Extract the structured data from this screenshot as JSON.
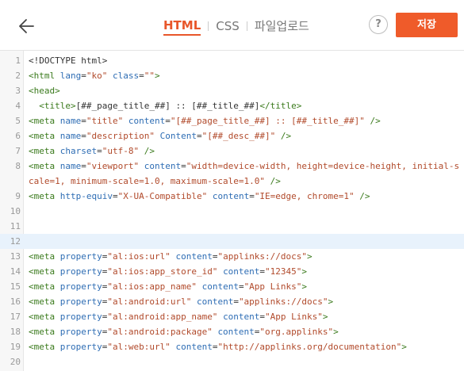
{
  "header": {
    "tabs": [
      {
        "label": "HTML"
      },
      {
        "label": "CSS"
      },
      {
        "label": "파일업로드"
      }
    ],
    "help_label": "?",
    "save_label": "저장"
  },
  "colors": {
    "accent": "#ef5b2a",
    "tag": "#3a7a1c",
    "attr": "#2e6db4",
    "value": "#b14a2b"
  },
  "editor": {
    "lines": [
      {
        "num": "1",
        "tokens": [
          {
            "t": "x",
            "s": "<!DOCTYPE html>"
          }
        ]
      },
      {
        "num": "2",
        "tokens": [
          {
            "t": "t",
            "s": "<html "
          },
          {
            "t": "a",
            "s": "lang"
          },
          {
            "t": "x",
            "s": "="
          },
          {
            "t": "v",
            "s": "\"ko\""
          },
          {
            "t": "x",
            "s": " "
          },
          {
            "t": "a",
            "s": "class"
          },
          {
            "t": "x",
            "s": "="
          },
          {
            "t": "v",
            "s": "\"\""
          },
          {
            "t": "t",
            "s": ">"
          }
        ]
      },
      {
        "num": "3",
        "tokens": [
          {
            "t": "t",
            "s": "<head>"
          }
        ]
      },
      {
        "num": "4",
        "tokens": [
          {
            "t": "x",
            "s": "  "
          },
          {
            "t": "t",
            "s": "<title>"
          },
          {
            "t": "x",
            "s": "[##_page_title_##] :: [##_title_##]"
          },
          {
            "t": "t",
            "s": "</title>"
          }
        ]
      },
      {
        "num": "5",
        "tokens": [
          {
            "t": "t",
            "s": "<meta "
          },
          {
            "t": "a",
            "s": "name"
          },
          {
            "t": "x",
            "s": "="
          },
          {
            "t": "v",
            "s": "\"title\""
          },
          {
            "t": "x",
            "s": " "
          },
          {
            "t": "a",
            "s": "content"
          },
          {
            "t": "x",
            "s": "="
          },
          {
            "t": "v",
            "s": "\"[##_page_title_##] :: [##_title_##]\""
          },
          {
            "t": "x",
            "s": " "
          },
          {
            "t": "t",
            "s": "/>"
          }
        ]
      },
      {
        "num": "6",
        "tokens": [
          {
            "t": "t",
            "s": "<meta "
          },
          {
            "t": "a",
            "s": "name"
          },
          {
            "t": "x",
            "s": "="
          },
          {
            "t": "v",
            "s": "\"description\""
          },
          {
            "t": "x",
            "s": " "
          },
          {
            "t": "a",
            "s": "Content"
          },
          {
            "t": "x",
            "s": "="
          },
          {
            "t": "v",
            "s": "\"[##_desc_##]\""
          },
          {
            "t": "x",
            "s": " "
          },
          {
            "t": "t",
            "s": "/>"
          }
        ]
      },
      {
        "num": "7",
        "tokens": [
          {
            "t": "t",
            "s": "<meta "
          },
          {
            "t": "a",
            "s": "charset"
          },
          {
            "t": "x",
            "s": "="
          },
          {
            "t": "v",
            "s": "\"utf-8\""
          },
          {
            "t": "x",
            "s": " "
          },
          {
            "t": "t",
            "s": "/>"
          }
        ]
      },
      {
        "num": "8",
        "tall": true,
        "tokens": [
          {
            "t": "t",
            "s": "<meta "
          },
          {
            "t": "a",
            "s": "name"
          },
          {
            "t": "x",
            "s": "="
          },
          {
            "t": "v",
            "s": "\"viewport\""
          },
          {
            "t": "x",
            "s": " "
          },
          {
            "t": "a",
            "s": "content"
          },
          {
            "t": "x",
            "s": "="
          },
          {
            "t": "v",
            "s": "\"width=device-width, height=device-height, initial-scale=1, minimum-scale=1.0, maximum-scale=1.0\""
          },
          {
            "t": "x",
            "s": " "
          },
          {
            "t": "t",
            "s": "/>"
          }
        ]
      },
      {
        "num": "9",
        "tokens": [
          {
            "t": "t",
            "s": "<meta "
          },
          {
            "t": "a",
            "s": "http-equiv"
          },
          {
            "t": "x",
            "s": "="
          },
          {
            "t": "v",
            "s": "\"X-UA-Compatible\""
          },
          {
            "t": "x",
            "s": " "
          },
          {
            "t": "a",
            "s": "content"
          },
          {
            "t": "x",
            "s": "="
          },
          {
            "t": "v",
            "s": "\"IE=edge, chrome=1\""
          },
          {
            "t": "x",
            "s": " "
          },
          {
            "t": "t",
            "s": "/>"
          }
        ]
      },
      {
        "num": "10",
        "tokens": []
      },
      {
        "num": "11",
        "tokens": []
      },
      {
        "num": "12",
        "active": true,
        "tokens": []
      },
      {
        "num": "13",
        "tokens": [
          {
            "t": "t",
            "s": "<meta "
          },
          {
            "t": "a",
            "s": "property"
          },
          {
            "t": "x",
            "s": "="
          },
          {
            "t": "v",
            "s": "\"al:ios:url\""
          },
          {
            "t": "x",
            "s": " "
          },
          {
            "t": "a",
            "s": "content"
          },
          {
            "t": "x",
            "s": "="
          },
          {
            "t": "v",
            "s": "\"applinks://docs\""
          },
          {
            "t": "t",
            "s": ">"
          }
        ]
      },
      {
        "num": "14",
        "tokens": [
          {
            "t": "t",
            "s": "<meta "
          },
          {
            "t": "a",
            "s": "property"
          },
          {
            "t": "x",
            "s": "="
          },
          {
            "t": "v",
            "s": "\"al:ios:app_store_id\""
          },
          {
            "t": "x",
            "s": " "
          },
          {
            "t": "a",
            "s": "content"
          },
          {
            "t": "x",
            "s": "="
          },
          {
            "t": "v",
            "s": "\"12345\""
          },
          {
            "t": "t",
            "s": ">"
          }
        ]
      },
      {
        "num": "15",
        "tokens": [
          {
            "t": "t",
            "s": "<meta "
          },
          {
            "t": "a",
            "s": "property"
          },
          {
            "t": "x",
            "s": "="
          },
          {
            "t": "v",
            "s": "\"al:ios:app_name\""
          },
          {
            "t": "x",
            "s": " "
          },
          {
            "t": "a",
            "s": "content"
          },
          {
            "t": "x",
            "s": "="
          },
          {
            "t": "v",
            "s": "\"App Links\""
          },
          {
            "t": "t",
            "s": ">"
          }
        ]
      },
      {
        "num": "16",
        "tokens": [
          {
            "t": "t",
            "s": "<meta "
          },
          {
            "t": "a",
            "s": "property"
          },
          {
            "t": "x",
            "s": "="
          },
          {
            "t": "v",
            "s": "\"al:android:url\""
          },
          {
            "t": "x",
            "s": " "
          },
          {
            "t": "a",
            "s": "content"
          },
          {
            "t": "x",
            "s": "="
          },
          {
            "t": "v",
            "s": "\"applinks://docs\""
          },
          {
            "t": "t",
            "s": ">"
          }
        ]
      },
      {
        "num": "17",
        "tokens": [
          {
            "t": "t",
            "s": "<meta "
          },
          {
            "t": "a",
            "s": "property"
          },
          {
            "t": "x",
            "s": "="
          },
          {
            "t": "v",
            "s": "\"al:android:app_name\""
          },
          {
            "t": "x",
            "s": " "
          },
          {
            "t": "a",
            "s": "content"
          },
          {
            "t": "x",
            "s": "="
          },
          {
            "t": "v",
            "s": "\"App Links\""
          },
          {
            "t": "t",
            "s": ">"
          }
        ]
      },
      {
        "num": "18",
        "tokens": [
          {
            "t": "t",
            "s": "<meta "
          },
          {
            "t": "a",
            "s": "property"
          },
          {
            "t": "x",
            "s": "="
          },
          {
            "t": "v",
            "s": "\"al:android:package\""
          },
          {
            "t": "x",
            "s": " "
          },
          {
            "t": "a",
            "s": "content"
          },
          {
            "t": "x",
            "s": "="
          },
          {
            "t": "v",
            "s": "\"org.applinks\""
          },
          {
            "t": "t",
            "s": ">"
          }
        ]
      },
      {
        "num": "19",
        "tokens": [
          {
            "t": "t",
            "s": "<meta "
          },
          {
            "t": "a",
            "s": "property"
          },
          {
            "t": "x",
            "s": "="
          },
          {
            "t": "v",
            "s": "\"al:web:url\""
          },
          {
            "t": "x",
            "s": " "
          },
          {
            "t": "a",
            "s": "content"
          },
          {
            "t": "x",
            "s": "="
          },
          {
            "t": "v",
            "s": "\"http://applinks.org/documentation\""
          },
          {
            "t": "t",
            "s": ">"
          }
        ]
      },
      {
        "num": "20",
        "tokens": []
      }
    ]
  }
}
